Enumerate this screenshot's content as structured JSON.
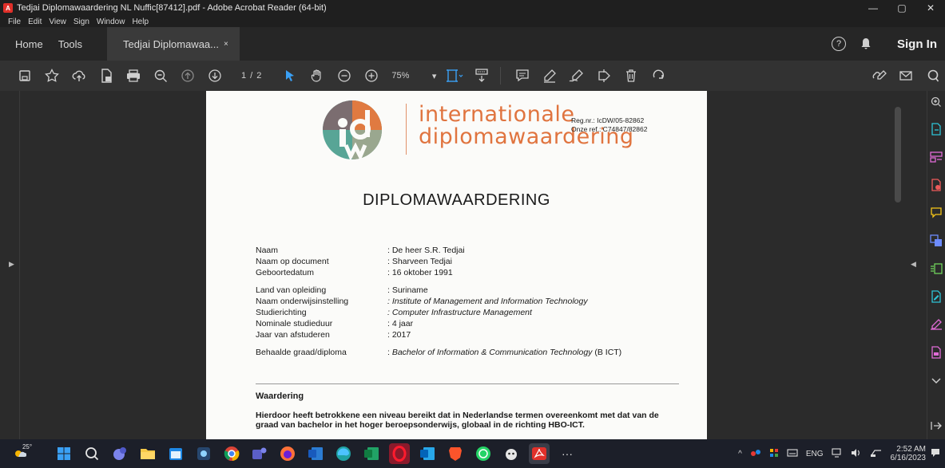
{
  "window": {
    "title": "Tedjai Diplomawaardering NL Nuffic[87412].pdf - Adobe Acrobat Reader (64-bit)",
    "app_icon": "acrobat-icon",
    "minimize": "—",
    "maximize": "▢",
    "close": "✕"
  },
  "menu": [
    "File",
    "Edit",
    "View",
    "Sign",
    "Window",
    "Help"
  ],
  "tabs": {
    "home": "Home",
    "tools": "Tools",
    "document": "Tedjai Diplomawaa...",
    "document_close": "×",
    "help": "?",
    "sign_in": "Sign In"
  },
  "toolbar": {
    "page_indicator": "1  /  2",
    "zoom": "75%",
    "zoom_caret": "▾"
  },
  "document": {
    "logo_line1": "internationale",
    "logo_line2": "diplomawaardering",
    "reg_nr": "Reg.nr.: IcDW/05-82862",
    "ref": "Onze ref.: C74847/82862",
    "heading": "DIPLOMAWAARDERING",
    "fields_group1": [
      {
        "label": "Naam",
        "value": ": De heer S.R. Tedjai"
      },
      {
        "label": "Naam op document",
        "value": ": Sharveen Tedjai"
      },
      {
        "label": "Geboortedatum",
        "value": ": 16 oktober 1991"
      }
    ],
    "fields_group2": [
      {
        "label": "Land van opleiding",
        "value": ": Suriname"
      },
      {
        "label": "Naam onderwijsinstelling",
        "value": ": Institute of Management and Information Technology"
      },
      {
        "label": "Studierichting",
        "value": ": Computer Infrastructure Management"
      },
      {
        "label": "Nominale studieduur",
        "value": ": 4 jaar"
      },
      {
        "label": "Jaar van afstuderen",
        "value": ": 2017"
      }
    ],
    "degree_label": "Behaalde graad/diploma",
    "degree_value_colon": ": ",
    "degree_value_italic": "Bachelor of Information & Communication Technology",
    "degree_value_suffix": " (B ICT)",
    "waardering_title": "Waardering",
    "waardering_text": "Hierdoor heeft betrokkene een niveau bereikt dat in Nederlandse termen overeenkomt met dat van de graad van bachelor in het hoger beroepsonderwijs, globaal in de richting HBO-ICT."
  },
  "taskbar": {
    "weather": "25°",
    "tray_lang": "ENG",
    "time": "2:52 AM",
    "date": "6/16/2023",
    "more": "···",
    "chevron": "^"
  },
  "colors": {
    "accent_blue": "#3aa0f5",
    "logo_orange": "#e0743f",
    "acrobat_red": "#e0302a"
  }
}
